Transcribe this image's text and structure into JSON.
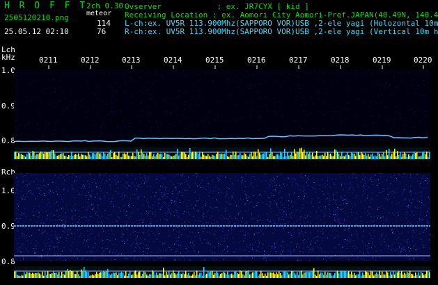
{
  "header": {
    "logo": "H R O F F T",
    "version": "2ch 0.30",
    "file_name": "2505120210.png",
    "meteor_label": "meteor",
    "lch_count": "114",
    "rch_count": "76",
    "datetime": "25.05.12 02:10",
    "observer": "Ovserver            : ex. JR7CYX [ kid ]",
    "location": "Receiving Location : ex. Aomori City Aomori-Pref.JAPAN(40.49N, 140.47E)",
    "lch_info": "L-ch:ex. UV5R 113.900Mhz(SAPPORO VOR)USB ,2-ele yagi (Holozontal 10m height)",
    "rch_info": "R-ch:ex. UV5R 113.900Mhz(SAPPORO VOR)USB ,2-ele yagi (Vertical 10m height)"
  },
  "lch": {
    "label": "Lch",
    "unit": "kHz"
  },
  "rch": {
    "label": "Rch"
  },
  "time_ticks": [
    "0211",
    "0212",
    "0213",
    "0214",
    "0215",
    "0216",
    "0217",
    "0218",
    "0219",
    "0220"
  ],
  "lch_freq_labels": [
    "1.0",
    "0.9",
    "0.8"
  ],
  "rch_freq_labels": [
    "1.0",
    "0.9",
    "0.8"
  ],
  "colors": {
    "text_green": "#00e000",
    "text_cyan": "#33e0ff",
    "text_white": "#ffffff",
    "bar_yellow": "#ffff33",
    "bar_cyan": "#33d0ff"
  }
}
